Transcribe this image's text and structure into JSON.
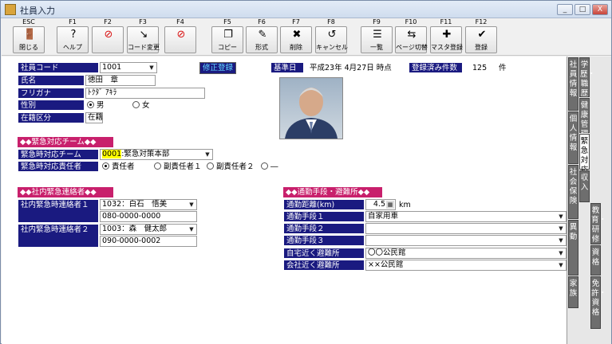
{
  "window": {
    "title": "社員入力",
    "min": "_",
    "max": "□",
    "close": "X"
  },
  "toolbar": [
    {
      "fkey": "ESC",
      "label": "閉じる",
      "icon": "door-icon",
      "glyph": "🚪"
    },
    {
      "fkey": "F1",
      "label": "ヘルプ",
      "icon": "help-icon",
      "glyph": "?"
    },
    {
      "fkey": "F2",
      "label": "",
      "icon": "no-icon",
      "glyph": "⊘"
    },
    {
      "fkey": "F3",
      "label": "コード変更",
      "icon": "code-change-icon",
      "glyph": "↘"
    },
    {
      "fkey": "F4",
      "label": "",
      "icon": "no-icon",
      "glyph": "⊘"
    },
    {
      "fkey": "F5",
      "label": "コピー",
      "icon": "copy-icon",
      "glyph": "❐"
    },
    {
      "fkey": "F6",
      "label": "形式",
      "icon": "format-icon",
      "glyph": "✎"
    },
    {
      "fkey": "F7",
      "label": "削除",
      "icon": "delete-icon",
      "glyph": "✖"
    },
    {
      "fkey": "F8",
      "label": "キャンセル",
      "icon": "cancel-icon",
      "glyph": "↺"
    },
    {
      "fkey": "F9",
      "label": "一覧",
      "icon": "list-icon",
      "glyph": "☰"
    },
    {
      "fkey": "F10",
      "label": "ページ切替",
      "icon": "page-switch-icon",
      "glyph": "⇆"
    },
    {
      "fkey": "F11",
      "label": "マスタ登録",
      "icon": "master-register-icon",
      "glyph": "✚"
    },
    {
      "fkey": "F12",
      "label": "登録",
      "icon": "register-icon",
      "glyph": "✔"
    }
  ],
  "form": {
    "code_label": "社員コード",
    "code_value": "1001",
    "status_badge": "修正登録",
    "kijunbi_label": "基準日",
    "kijunbi_value": "平成23年 4月27日 時点",
    "count_label": "登録済み件数",
    "count_value": "125",
    "count_unit": "件",
    "name_label": "氏名",
    "name_value": "徳田　章",
    "kana_label": "フリガナ",
    "kana_value": "ﾄｸﾀﾞ ｱｷﾗ",
    "gender_label": "性別",
    "gender_male": "男",
    "gender_female": "女",
    "zaiseki_label": "在籍区分",
    "zaiseki_value": "在籍"
  },
  "emergency": {
    "section": "◆◆緊急対応チーム◆◆",
    "team_label": "緊急時対応チーム",
    "team_code": "0001",
    "team_name": ":緊急対策本部",
    "role_label": "緊急時対応責任者",
    "role1": "責任者",
    "role2": "副責任者１",
    "role3": "副責任者２",
    "role4": "―"
  },
  "contacts": {
    "section": "◆◆社内緊急連絡者◆◆",
    "c1_label": "社内緊急時連絡者１",
    "c1_name": "1032：白石　悟美",
    "c1_phone": "080-0000-0000",
    "c2_label": "社内緊急時連絡者２",
    "c2_name": "1003：森　健太郎",
    "c2_phone": "090-0000-0002"
  },
  "commute": {
    "section": "◆◆通勤手段・避難所◆◆",
    "dist_label": "通勤距離(km)",
    "dist_value": "4.5",
    "dist_unit": "km",
    "m1_label": "通勤手段１",
    "m1_value": "自家用車",
    "m2_label": "通勤手段２",
    "m2_value": "",
    "m3_label": "通勤手段３",
    "m3_value": "",
    "home_label": "自宅近く避難所",
    "home_value": "〇〇公民館",
    "office_label": "会社近く避難所",
    "office_value": "××公民館"
  },
  "tabs": {
    "t1": "社員情報",
    "t2": "個人情報",
    "t3": "社会保険",
    "t4": "異動",
    "t5": "家族",
    "t6": "学歴・職歴",
    "t7": "健康管理",
    "t8": "緊急対応",
    "t9": "収入",
    "t10": "教育・研修",
    "t11": "資格",
    "t12": "免許・資格"
  }
}
